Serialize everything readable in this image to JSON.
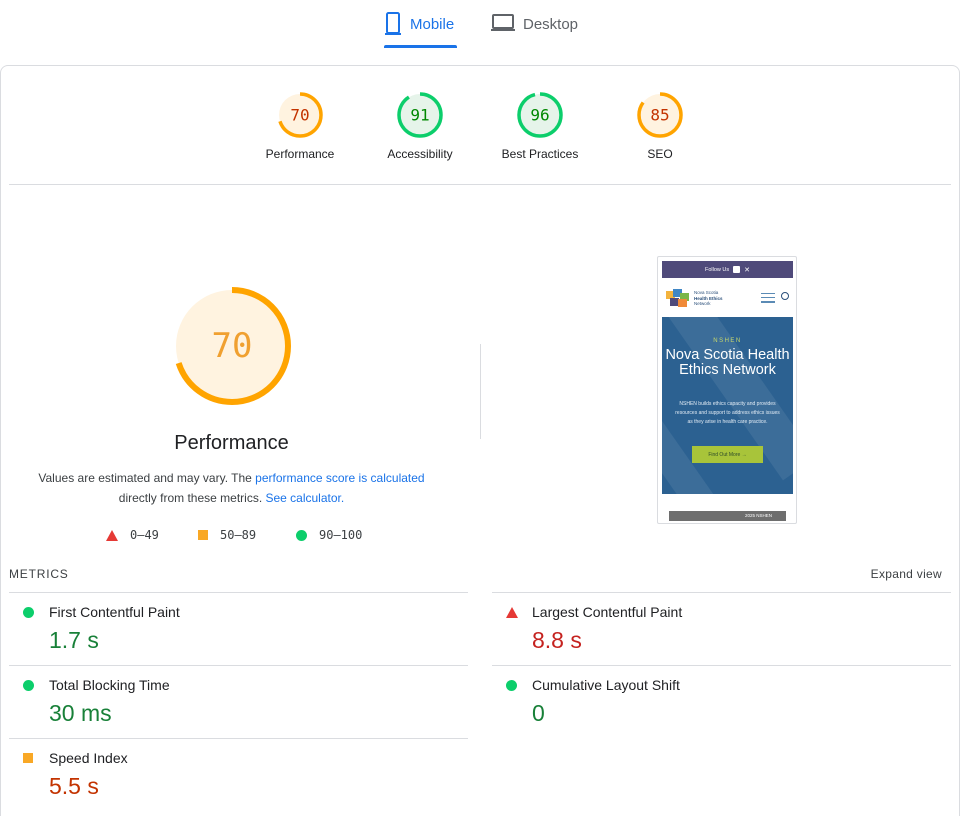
{
  "tabs": [
    {
      "label": "Mobile",
      "icon": "phone-icon",
      "active": true
    },
    {
      "label": "Desktop",
      "icon": "monitor-icon",
      "active": false
    }
  ],
  "scores": [
    {
      "label": "Performance",
      "value": "70",
      "fraction": 0.7,
      "color": "#ffa400",
      "text_color": "#c33300",
      "bg": "#fff3e0"
    },
    {
      "label": "Accessibility",
      "value": "91",
      "fraction": 0.91,
      "color": "#0cce6b",
      "text_color": "#008800",
      "bg": "#e6f4ea"
    },
    {
      "label": "Best Practices",
      "value": "96",
      "fraction": 0.96,
      "color": "#0cce6b",
      "text_color": "#008800",
      "bg": "#e6f4ea"
    },
    {
      "label": "SEO",
      "value": "85",
      "fraction": 0.85,
      "color": "#ffa400",
      "text_color": "#c33300",
      "bg": "#fff3e0"
    }
  ],
  "performance": {
    "score": "70",
    "fraction": 0.7,
    "title": "Performance",
    "desc_prefix": "Values are estimated and may vary. The ",
    "desc_link1": "performance score is calculated",
    "desc_middle": "directly from these metrics. ",
    "desc_link2": "See calculator.",
    "legend": [
      {
        "range": "0–49",
        "shape": "triangle",
        "color": "#e53935"
      },
      {
        "range": "50–89",
        "shape": "square",
        "color": "#f9a825"
      },
      {
        "range": "90–100",
        "shape": "circle",
        "color": "#0cce6b"
      }
    ]
  },
  "preview": {
    "topbar": "Follow Us",
    "logo_line1": "Nova Scotia",
    "logo_line2": "Health Ethics",
    "logo_line3": "Network",
    "kicker": "NSHEN",
    "title": "Nova Scotia Health Ethics Network",
    "body": "NSHEN builds ethics capacity and provides resources and support to address ethics issues as they arise in health care practice.",
    "button": "Find Out More →",
    "footer": "2025 NSHEN"
  },
  "metrics_section": {
    "title": "METRICS",
    "expand_label": "Expand view"
  },
  "metrics": [
    {
      "name": "First Contentful Paint",
      "value": "1.7 s",
      "status": "good"
    },
    {
      "name": "Largest Contentful Paint",
      "value": "8.8 s",
      "status": "poor"
    },
    {
      "name": "Total Blocking Time",
      "value": "30 ms",
      "status": "good"
    },
    {
      "name": "Cumulative Layout Shift",
      "value": "0",
      "status": "good"
    },
    {
      "name": "Speed Index",
      "value": "5.5 s",
      "status": "average"
    }
  ]
}
